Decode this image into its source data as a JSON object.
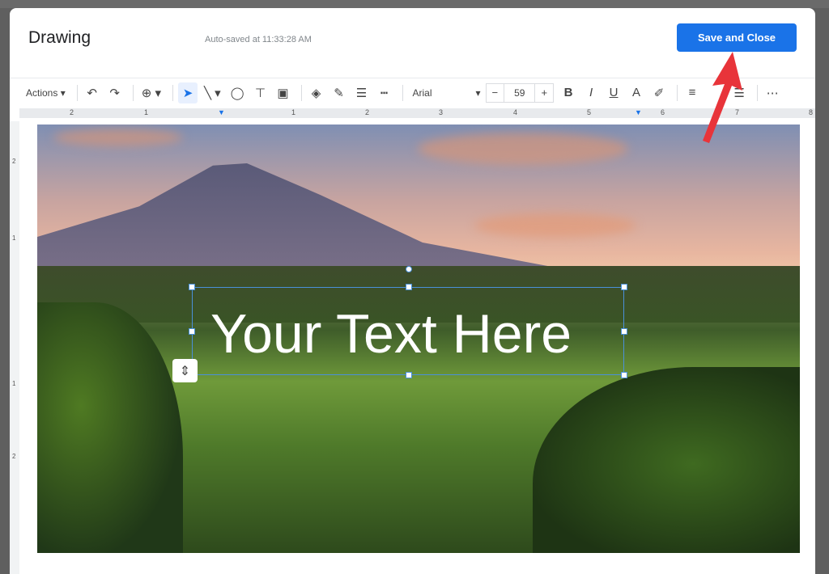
{
  "dialog": {
    "title": "Drawing",
    "autosave": "Auto-saved at 11:33:28 AM",
    "save_label": "Save and Close"
  },
  "toolbar": {
    "actions": "Actions",
    "font": "Arial",
    "font_size": "59",
    "minus": "−",
    "plus": "+",
    "bold": "B",
    "italic": "I",
    "underline": "U",
    "text_color": "A",
    "more": "⋯"
  },
  "ruler": {
    "labels": [
      "2",
      "1",
      "1",
      "2",
      "3",
      "4",
      "5",
      "6",
      "7",
      "8"
    ]
  },
  "vruler": {
    "labels": [
      "2",
      "1",
      "1",
      "2"
    ]
  },
  "canvas": {
    "text": "Your Text Here"
  },
  "colors": {
    "accent": "#1a73e8",
    "selection": "#4a90d9",
    "arrow": "#e8343a"
  }
}
